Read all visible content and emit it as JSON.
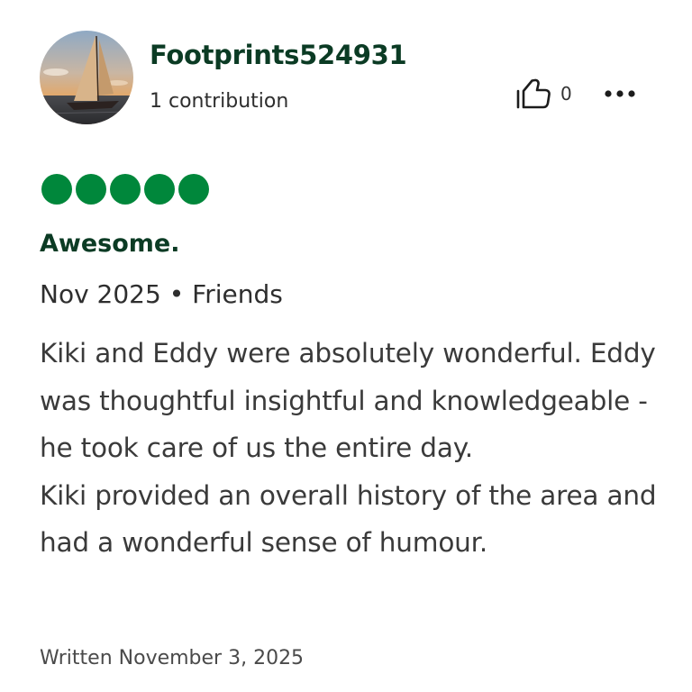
{
  "reviewer": {
    "username": "Footprints524931",
    "contributions": "1 contribution"
  },
  "actions": {
    "helpful_count": "0",
    "helpful_icon": "thumbs-up-icon",
    "more_icon": "more-options-icon"
  },
  "review": {
    "rating": 5,
    "rating_max": 5,
    "rating_color": "#00873b",
    "title": "Awesome.",
    "visit_info": "Nov 2025 • Friends",
    "body_paragraphs": [
      "Kiki and Eddy were absolutely wonderful. Eddy was thoughtful insightful and knowledgeable - he took care of us the entire day.",
      "Kiki provided an overall history of the area and had a wonderful sense of humour."
    ],
    "written_date": "Written November 3, 2025"
  },
  "colors": {
    "title_green": "#0b3b24",
    "bubble_green": "#00873b"
  }
}
